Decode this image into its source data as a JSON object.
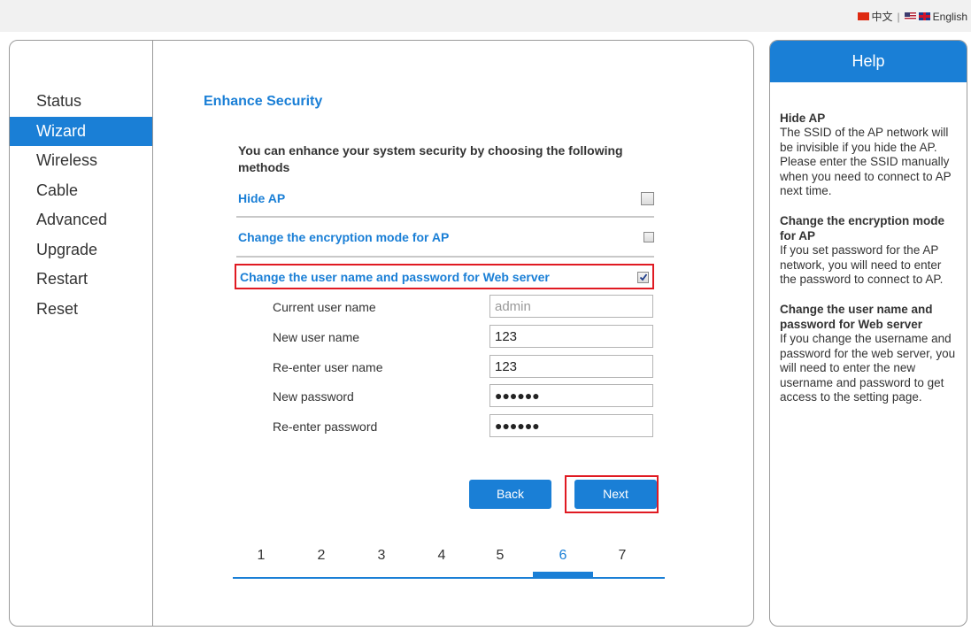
{
  "lang_bar": {
    "chinese": "中文",
    "separator": "|",
    "english": "English"
  },
  "sidebar": {
    "items": [
      {
        "label": "Status"
      },
      {
        "label": "Wizard"
      },
      {
        "label": "Wireless"
      },
      {
        "label": "Cable"
      },
      {
        "label": "Advanced"
      },
      {
        "label": "Upgrade"
      },
      {
        "label": "Restart"
      },
      {
        "label": "Reset"
      }
    ],
    "active": "Wizard"
  },
  "main": {
    "title": "Enhance Security",
    "intro": "You can enhance your system security by choosing the following methods",
    "options": [
      {
        "label": "Hide AP",
        "checked": false
      },
      {
        "label": "Change the encryption mode for AP",
        "checked": false
      },
      {
        "label": "Change the user name and password for Web server",
        "checked": true
      }
    ],
    "form": {
      "current_user_label": "Current user name",
      "current_user_value": "admin",
      "new_user_label": "New user name",
      "new_user_value": "123",
      "reenter_user_label": "Re-enter user name",
      "reenter_user_value": "123",
      "new_password_label": "New password",
      "new_password_value": "●●●●●●",
      "reenter_password_label": "Re-enter password",
      "reenter_password_value": "●●●●●●"
    },
    "buttons": {
      "back": "Back",
      "next": "Next"
    },
    "steps": [
      "1",
      "2",
      "3",
      "4",
      "5",
      "6",
      "7"
    ],
    "current_step": "6"
  },
  "help": {
    "title": "Help",
    "sections": [
      {
        "heading": "Hide AP",
        "text": "The SSID of the AP network will be invisible if you hide the AP. Please enter the SSID manually when you need to connect to AP next time."
      },
      {
        "heading": "Change the encryption mode for AP",
        "text": "If you set password for the AP network, you will need to enter the password to connect to AP."
      },
      {
        "heading": "Change the user name and password for Web server",
        "text": "If you change the username and password for the web server, you will need to enter the new username and password to get access to the setting page."
      }
    ]
  },
  "colors": {
    "accent": "#1a7fd6",
    "highlight": "#e01a22"
  }
}
